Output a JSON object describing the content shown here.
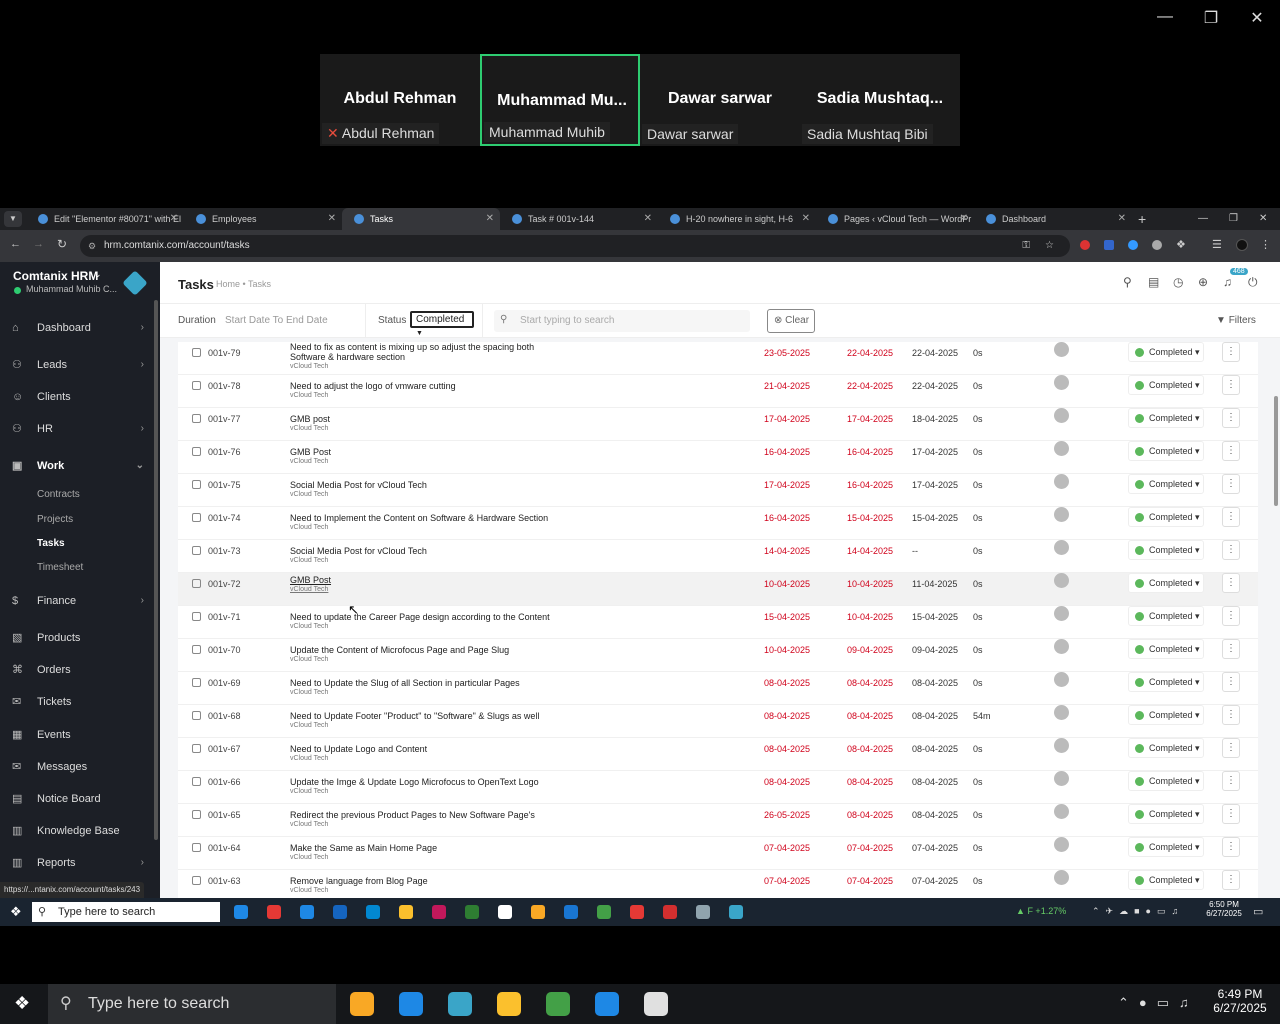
{
  "zoom": {
    "participants": [
      {
        "name": "Abdul Rehman",
        "label": "Abdul Rehman",
        "muted": true
      },
      {
        "name": "Muhammad Mu...",
        "label": "Muhammad Muhib",
        "active": true
      },
      {
        "name": "Dawar sarwar",
        "label": "Dawar sarwar"
      },
      {
        "name": "Sadia Mushtaq...",
        "label": "Sadia Mushtaq Bibi"
      }
    ]
  },
  "browser": {
    "tabs": [
      {
        "label": "Edit \"Elementor #80071\" with El"
      },
      {
        "label": "Employees"
      },
      {
        "label": "Tasks",
        "active": true
      },
      {
        "label": "Task # 001v-144"
      },
      {
        "label": "H-20 nowhere in sight, H-6"
      },
      {
        "label": "Pages ‹ vCloud Tech — WordPr"
      },
      {
        "label": "Dashboard"
      }
    ],
    "url": "hrm.comtanix.com/account/tasks",
    "status_url": "https://...ntanix.com/account/tasks/243"
  },
  "sidebar": {
    "company": "Comtanix HRM",
    "user": "Muhammad Muhib C...",
    "items": [
      {
        "label": "Dashboard",
        "icon": "home-icon",
        "arrow": true
      },
      {
        "label": "Leads",
        "icon": "users-icon",
        "arrow": true
      },
      {
        "label": "Clients",
        "icon": "user-icon",
        "arrow": false
      },
      {
        "label": "HR",
        "icon": "people-icon",
        "arrow": true
      },
      {
        "label": "Work",
        "icon": "briefcase-icon",
        "arrow": true,
        "open": true
      },
      {
        "label": "Finance",
        "icon": "dollar-icon",
        "arrow": true
      },
      {
        "label": "Products",
        "icon": "cube-icon",
        "arrow": false
      },
      {
        "label": "Orders",
        "icon": "cart-icon",
        "arrow": false
      },
      {
        "label": "Tickets",
        "icon": "ticket-icon",
        "arrow": false
      },
      {
        "label": "Events",
        "icon": "calendar-icon",
        "arrow": false
      },
      {
        "label": "Messages",
        "icon": "message-icon",
        "arrow": false
      },
      {
        "label": "Notice Board",
        "icon": "notice-icon",
        "arrow": false
      },
      {
        "label": "Knowledge Base",
        "icon": "book-icon",
        "arrow": false
      },
      {
        "label": "Reports",
        "icon": "chart-icon",
        "arrow": true
      }
    ],
    "work_sub": [
      "Contracts",
      "Projects",
      "Tasks",
      "Timesheet"
    ]
  },
  "header": {
    "title": "Tasks",
    "breadcrumb": "Home • Tasks",
    "notif_count": "468"
  },
  "filters": {
    "duration_label": "Duration",
    "duration_value": "Start Date To End Date",
    "status_label": "Status",
    "status_value": "Completed",
    "search_placeholder": "Start typing to search",
    "clear": "Clear",
    "filters": "Filters"
  },
  "tasks": [
    {
      "code": "001v-79",
      "title": "Need to fix as content is mixing up so adjust the spacing both Software & hardware section",
      "client": "vCloud Tech",
      "start": "23-05-2025",
      "due": "22-04-2025",
      "completed": "22-04-2025",
      "hours": "0s",
      "status": "Completed"
    },
    {
      "code": "001v-78",
      "title": "Need to adjust the logo of vmware cutting",
      "client": "vCloud Tech",
      "start": "21-04-2025",
      "due": "22-04-2025",
      "completed": "22-04-2025",
      "hours": "0s",
      "status": "Completed"
    },
    {
      "code": "001v-77",
      "title": "GMB post",
      "client": "vCloud Tech",
      "start": "17-04-2025",
      "due": "17-04-2025",
      "completed": "18-04-2025",
      "hours": "0s",
      "status": "Completed"
    },
    {
      "code": "001v-76",
      "title": "GMB Post",
      "client": "vCloud Tech",
      "start": "16-04-2025",
      "due": "16-04-2025",
      "completed": "17-04-2025",
      "hours": "0s",
      "status": "Completed"
    },
    {
      "code": "001v-75",
      "title": "Social Media Post for vCloud Tech",
      "client": "vCloud Tech",
      "start": "17-04-2025",
      "due": "16-04-2025",
      "completed": "17-04-2025",
      "hours": "0s",
      "status": "Completed"
    },
    {
      "code": "001v-74",
      "title": "Need to Implement the Content on Software & Hardware Section",
      "client": "vCloud Tech",
      "start": "16-04-2025",
      "due": "15-04-2025",
      "completed": "15-04-2025",
      "hours": "0s",
      "status": "Completed"
    },
    {
      "code": "001v-73",
      "title": "Social Media Post for vCloud Tech",
      "client": "vCloud Tech",
      "start": "14-04-2025",
      "due": "14-04-2025",
      "completed": "--",
      "hours": "0s",
      "status": "Completed"
    },
    {
      "code": "001v-72",
      "title": "GMB Post",
      "client": "vCloud Tech",
      "start": "10-04-2025",
      "due": "10-04-2025",
      "completed": "11-04-2025",
      "hours": "0s",
      "status": "Completed",
      "hl": true
    },
    {
      "code": "001v-71",
      "title": "Need to update the Career Page design according to the Content",
      "client": "vCloud Tech",
      "start": "15-04-2025",
      "due": "10-04-2025",
      "completed": "15-04-2025",
      "hours": "0s",
      "status": "Completed"
    },
    {
      "code": "001v-70",
      "title": "Update the Content of Microfocus Page and Page Slug",
      "client": "vCloud Tech",
      "start": "10-04-2025",
      "due": "09-04-2025",
      "completed": "09-04-2025",
      "hours": "0s",
      "status": "Completed"
    },
    {
      "code": "001v-69",
      "title": "Need to Update the Slug of all Section in particular Pages",
      "client": "vCloud Tech",
      "start": "08-04-2025",
      "due": "08-04-2025",
      "completed": "08-04-2025",
      "hours": "0s",
      "status": "Completed"
    },
    {
      "code": "001v-68",
      "title": "Need to Update Footer \"Product\" to \"Software\" & Slugs as well",
      "client": "vCloud Tech",
      "start": "08-04-2025",
      "due": "08-04-2025",
      "completed": "08-04-2025",
      "hours": "54m",
      "status": "Completed"
    },
    {
      "code": "001v-67",
      "title": "Need to Update Logo and Content",
      "client": "vCloud Tech",
      "start": "08-04-2025",
      "due": "08-04-2025",
      "completed": "08-04-2025",
      "hours": "0s",
      "status": "Completed"
    },
    {
      "code": "001v-66",
      "title": "Update the Imge & Update Logo Microfocus to OpenText Logo",
      "client": "vCloud Tech",
      "start": "08-04-2025",
      "due": "08-04-2025",
      "completed": "08-04-2025",
      "hours": "0s",
      "status": "Completed"
    },
    {
      "code": "001v-65",
      "title": "Redirect the previous Product Pages to New Software Page's",
      "client": "vCloud Tech",
      "start": "26-05-2025",
      "due": "08-04-2025",
      "completed": "08-04-2025",
      "hours": "0s",
      "status": "Completed"
    },
    {
      "code": "001v-64",
      "title": "Make the Same as Main Home Page",
      "client": "vCloud Tech",
      "start": "07-04-2025",
      "due": "07-04-2025",
      "completed": "07-04-2025",
      "hours": "0s",
      "status": "Completed"
    },
    {
      "code": "001v-63",
      "title": "Remove language from Blog Page",
      "client": "vCloud Tech",
      "start": "07-04-2025",
      "due": "07-04-2025",
      "completed": "07-04-2025",
      "hours": "0s",
      "status": "Completed"
    }
  ],
  "taskbar_inner": {
    "search": "Type here to search",
    "stock": "F +1.27%",
    "time": "6:50 PM",
    "date": "6/27/2025"
  },
  "taskbar_outer": {
    "search": "Type here to search",
    "time": "6:49 PM",
    "date": "6/27/2025"
  }
}
